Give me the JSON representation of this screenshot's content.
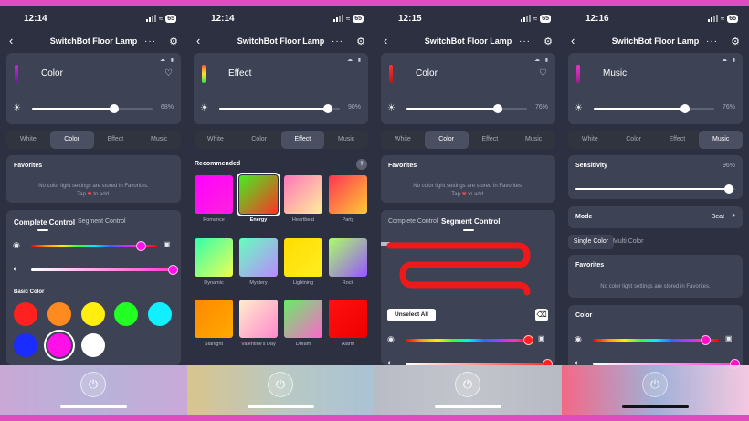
{
  "common": {
    "title": "SwitchBot Floor Lamp",
    "tabs": [
      "White",
      "Color",
      "Effect",
      "Music"
    ],
    "back_icon": "chevron-left-icon",
    "more_icon": "more-dots-icon",
    "settings_icon": "gear-icon"
  },
  "phones": [
    {
      "time": "12:14",
      "battery": "65",
      "mode": "Color",
      "brightness": "68%",
      "active_tab": "Color",
      "favorites": {
        "title": "Favorites",
        "empty_line1": "No color light settings are stored in Favorites.",
        "empty_line2_a": "Tap",
        "empty_line2_b": "to add."
      },
      "control_tabs": {
        "active": "Complete Control",
        "inactive": "Segment Control"
      },
      "basic_color_title": "Basic Color",
      "basic_colors": [
        "#ff2020",
        "#ff8a1f",
        "#ffee10",
        "#22ff22",
        "#10f0ff",
        "#1a2cff",
        "#ff10e8",
        "#ffffff"
      ],
      "selected_color_index": 6,
      "hue_level": 0.88,
      "saturation_level": 1.0
    },
    {
      "time": "12:14",
      "battery": "65",
      "mode": "Effect",
      "brightness": "90%",
      "active_tab": "Effect",
      "recommended_title": "Recommended",
      "effects": [
        {
          "name": "Romance",
          "from": "#ff00ff",
          "to": "#ff22dd"
        },
        {
          "name": "Energy",
          "from": "#44ee22",
          "to": "#ff3322"
        },
        {
          "name": "Heartbeat",
          "from": "#ff77bb",
          "to": "#ffee99"
        },
        {
          "name": "Party",
          "from": "#ff3355",
          "to": "#ffcc33"
        },
        {
          "name": "Dynamic",
          "from": "#33ffaa",
          "to": "#eeff55"
        },
        {
          "name": "Mystery",
          "from": "#66ffbb",
          "to": "#bb88ff"
        },
        {
          "name": "Lightning",
          "from": "#ffdd00",
          "to": "#ffee22"
        },
        {
          "name": "Rock",
          "from": "#aaff66",
          "to": "#9955ff"
        },
        {
          "name": "Starlight",
          "from": "#ff8800",
          "to": "#ffaa00"
        },
        {
          "name": "Valentine's Day",
          "from": "#ffeecc",
          "to": "#ff88cc"
        },
        {
          "name": "Dream",
          "from": "#66ee66",
          "to": "#ff66cc"
        },
        {
          "name": "Alarm",
          "from": "#ff1111",
          "to": "#ee0000"
        }
      ],
      "selected_effect_index": 1
    },
    {
      "time": "12:15",
      "battery": "65",
      "mode": "Color",
      "brightness": "76%",
      "active_tab": "Color",
      "favorites": {
        "title": "Favorites",
        "empty_line1": "No color light settings are stored in Favorites.",
        "empty_line2_a": "Tap",
        "empty_line2_b": "to add."
      },
      "control_tabs": {
        "active": "Segment Control",
        "inactive": "Complete Control"
      },
      "unselect_all": "Unselect All",
      "hue_level": 0.98,
      "saturation_level": 1.0
    },
    {
      "time": "12:16",
      "battery": "65",
      "mode": "Music",
      "brightness": "76%",
      "active_tab": "Music",
      "sensitivity": {
        "label": "Sensitivity",
        "value": "96%",
        "level": 0.96
      },
      "mode_row": {
        "label": "Mode",
        "value": "Beat"
      },
      "color_tabs": {
        "active": "Single Color",
        "inactive": "Multi Color"
      },
      "favorites": {
        "title": "Favorites",
        "empty_line1": "No color light settings are stored in Favorites."
      },
      "color_title": "Color",
      "hue_level": 0.9,
      "saturation_level": 1.0
    }
  ]
}
